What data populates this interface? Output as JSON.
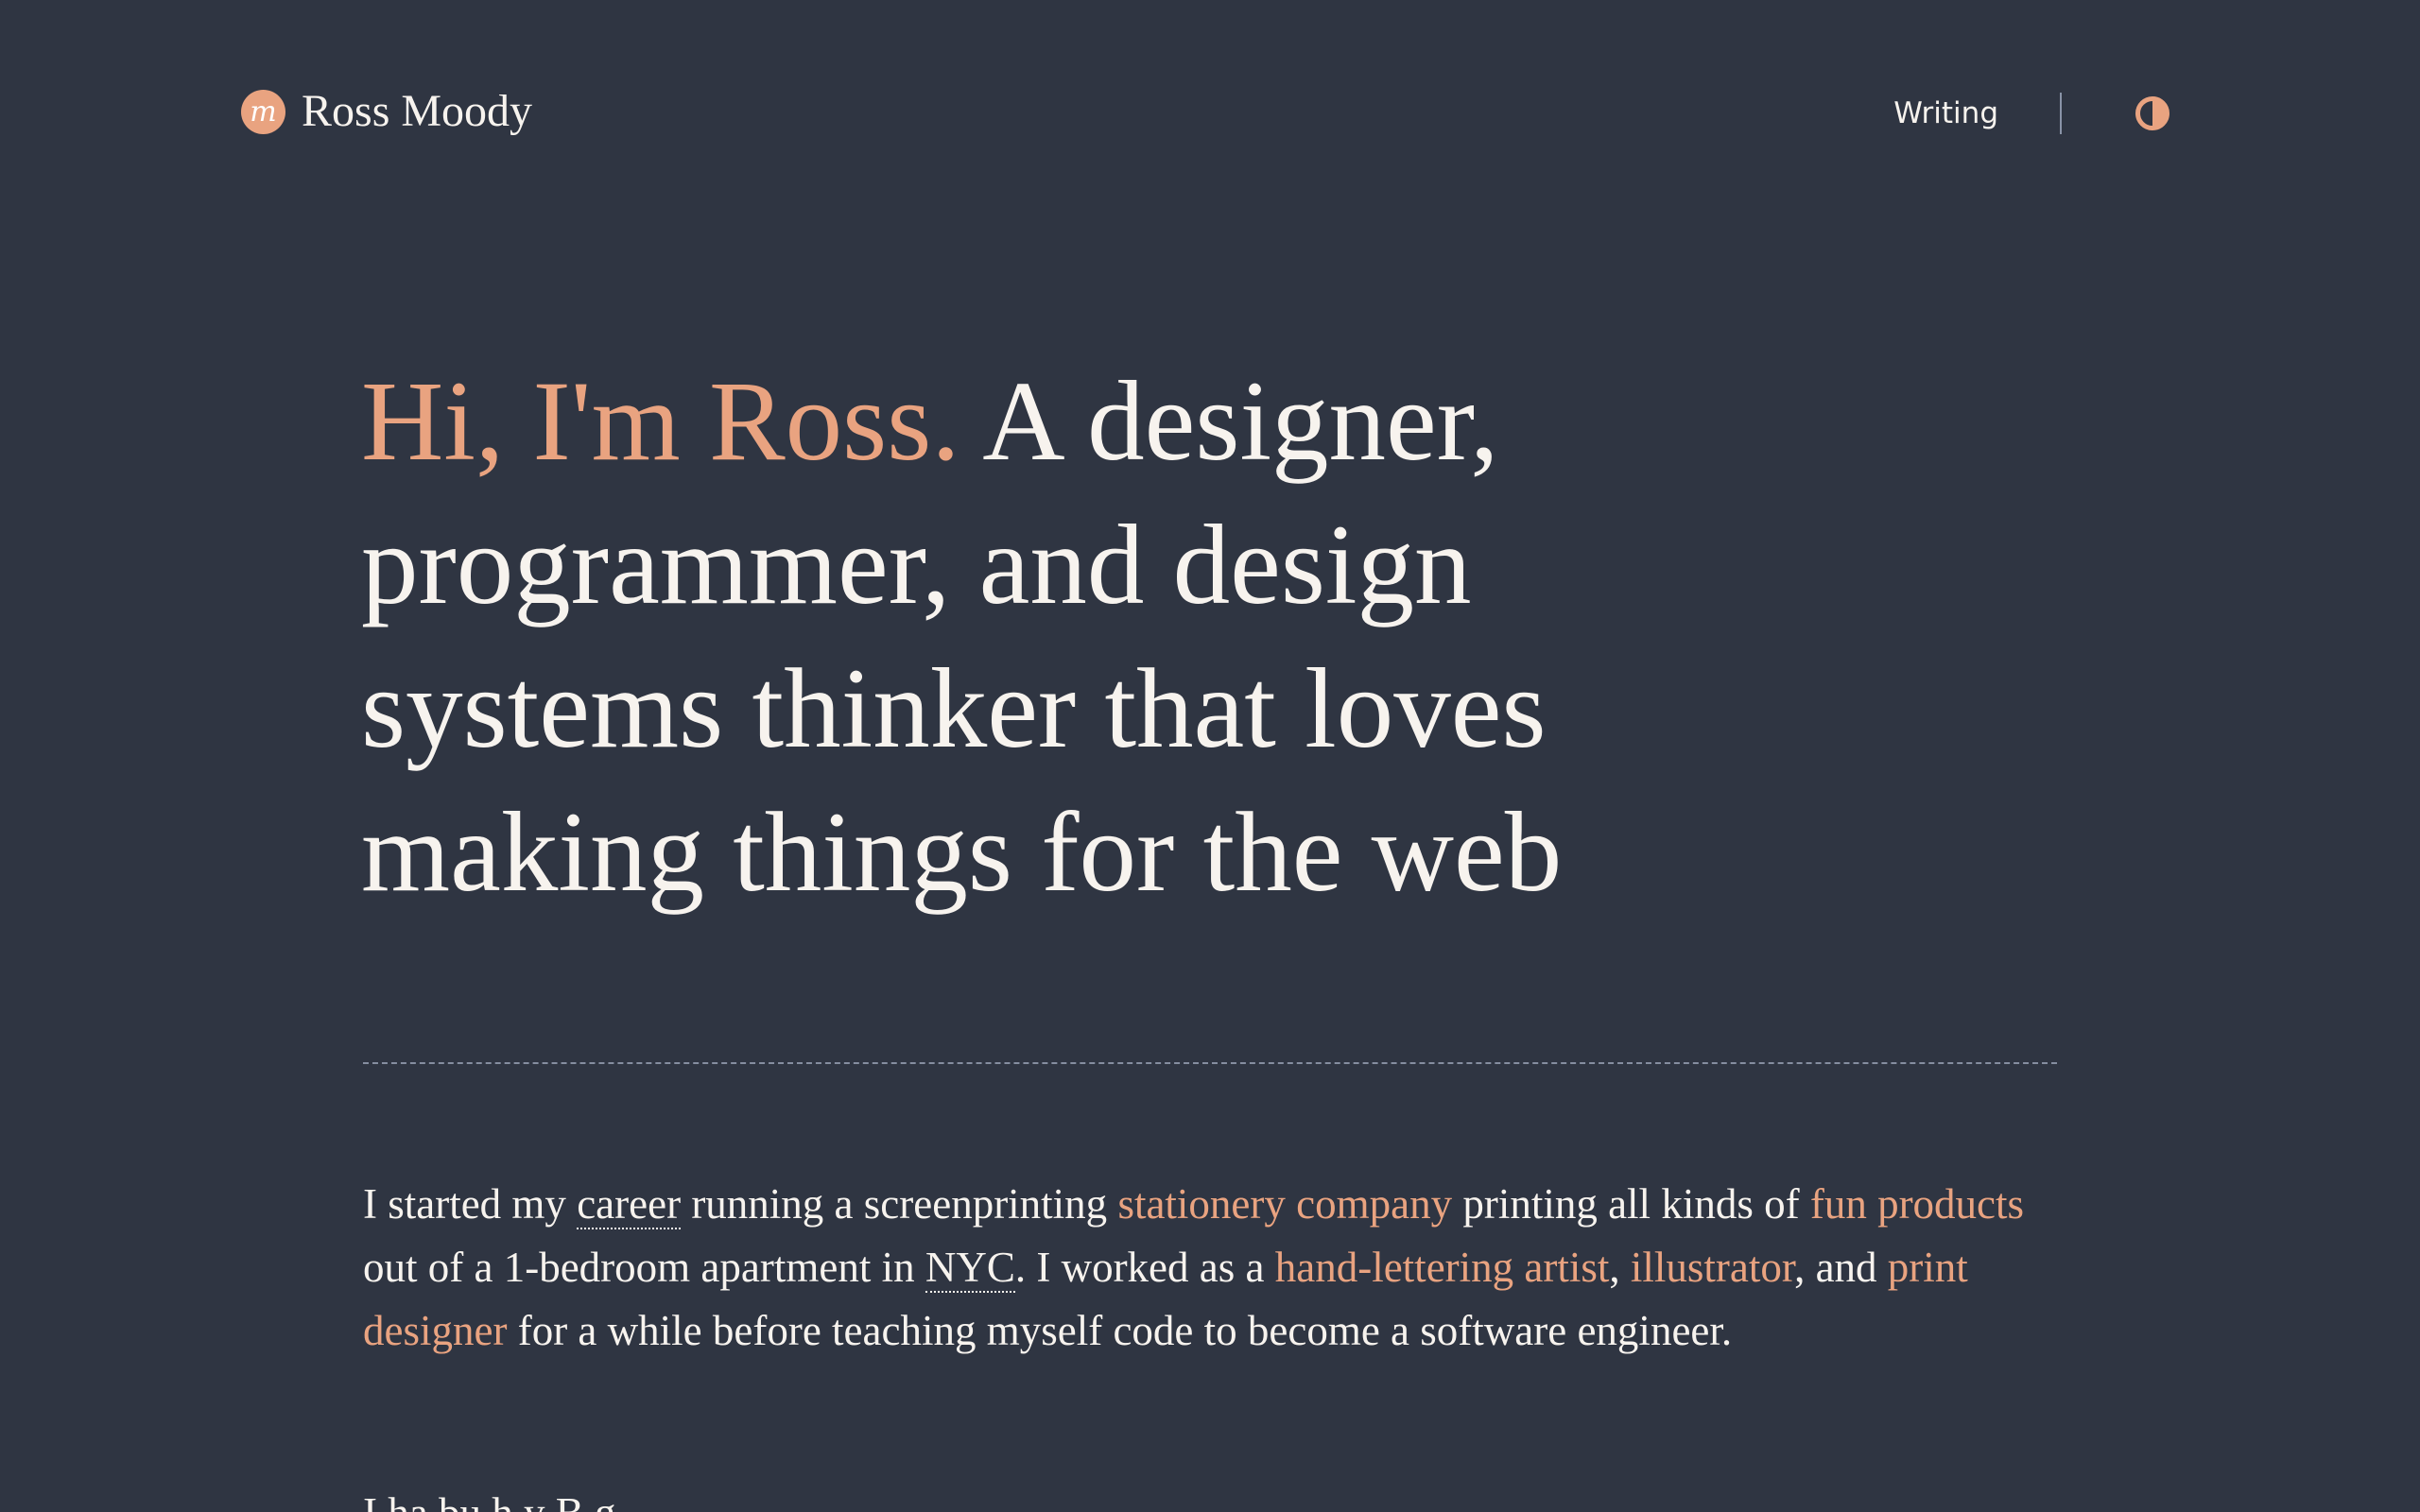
{
  "brand": {
    "name": "Ross Moody",
    "logo_letter": "m"
  },
  "nav": {
    "writing": "Writing"
  },
  "theme_toggle": {
    "icon": "contrast-icon",
    "accent_color": "#e9a380"
  },
  "hero": {
    "greeting": "Hi, I'm Ross.",
    "line_1": "A designer,",
    "line_2": "programmer, and design",
    "line_3": "systems thinker that loves",
    "line_4": "making things for the web"
  },
  "intro": {
    "segment_1": "I started my ",
    "career": "career",
    "segment_2": " running a screenprinting ",
    "stationery_company": "stationery company",
    "segment_3": " printing all kinds of ",
    "fun_products": "fun products",
    "segment_4": " out of a 1-bedroom apartment in ",
    "nyc": "NYC",
    "segment_5": ". I worked as a ",
    "hand_lettering_artist": "hand-lettering artist",
    "comma_1": ", ",
    "illustrator": "illustrator",
    "segment_6": ", and ",
    "print_designer": "print designer",
    "segment_7": " for a while before teaching myself code to become a software engineer."
  },
  "next_paragraph": {
    "visible_start": "I ha bu h y B g"
  },
  "colors": {
    "background": "#2f3542",
    "text": "#f7f3ee",
    "accent": "#e9a380"
  }
}
